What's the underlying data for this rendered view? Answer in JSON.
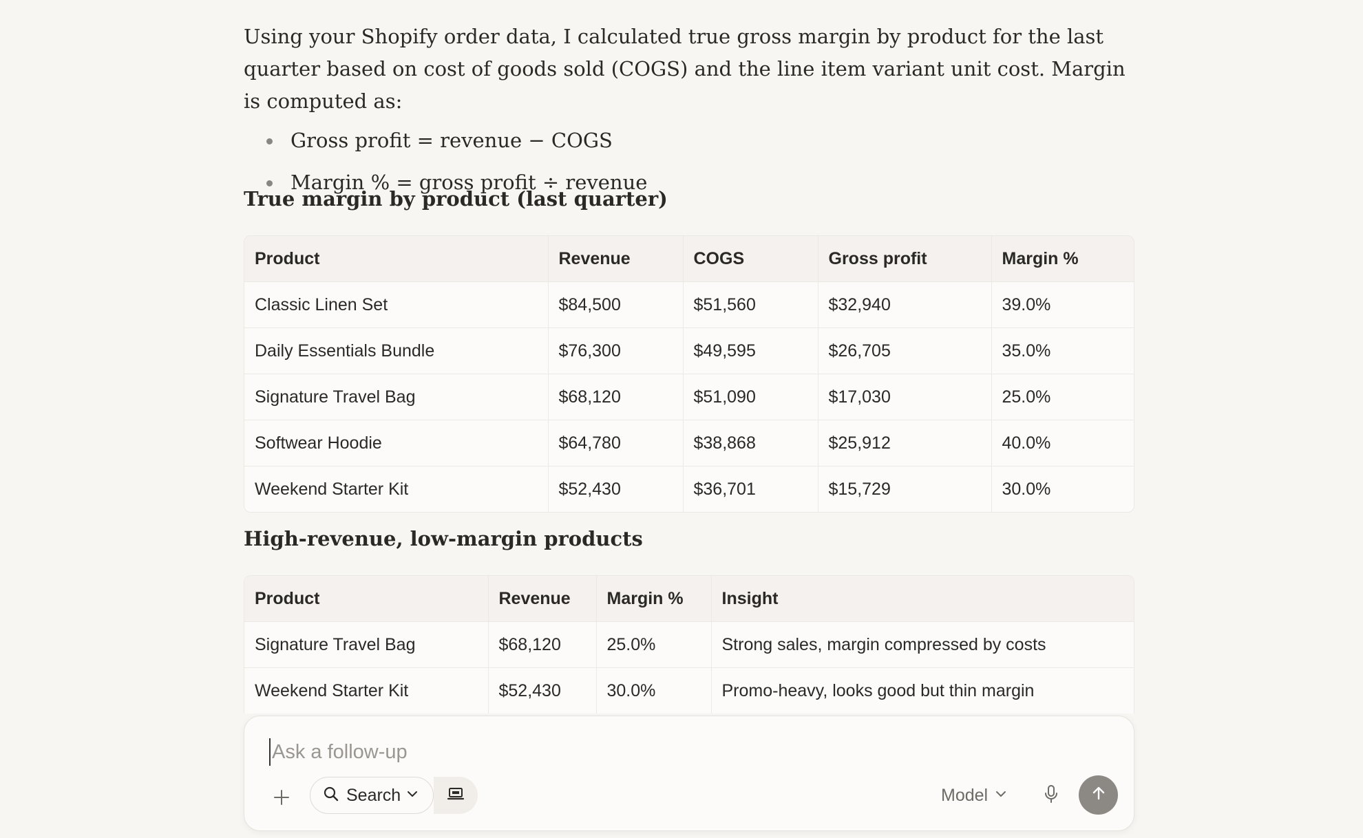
{
  "intro": {
    "paragraph": "Using your Shopify order data, I calculated true gross margin by product for the last quarter based on cost of goods sold (COGS) and the line item variant unit cost. Margin is computed as:",
    "bullets": [
      "Gross profit = revenue − COGS",
      "Margin % = gross profit ÷ revenue"
    ]
  },
  "margin_table": {
    "heading": "True margin by product (last quarter)",
    "headers": [
      "Product",
      "Revenue",
      "COGS",
      "Gross profit",
      "Margin %"
    ],
    "rows": [
      [
        "Classic Linen Set",
        "$84,500",
        "$51,560",
        "$32,940",
        "39.0%"
      ],
      [
        "Daily Essentials Bundle",
        "$76,300",
        "$49,595",
        "$26,705",
        "35.0%"
      ],
      [
        "Signature Travel Bag",
        "$68,120",
        "$51,090",
        "$17,030",
        "25.0%"
      ],
      [
        "Softwear Hoodie",
        "$64,780",
        "$38,868",
        "$25,912",
        "40.0%"
      ],
      [
        "Weekend Starter Kit",
        "$52,430",
        "$36,701",
        "$15,729",
        "30.0%"
      ]
    ]
  },
  "low_margin_table": {
    "heading": "High-revenue, low-margin products",
    "headers": [
      "Product",
      "Revenue",
      "Margin %",
      "Insight"
    ],
    "rows": [
      [
        "Signature Travel Bag",
        "$68,120",
        "25.0%",
        "Strong sales, margin compressed by costs"
      ],
      [
        "Weekend Starter Kit",
        "$52,430",
        "30.0%",
        "Promo-heavy, looks good but thin margin"
      ]
    ]
  },
  "composer": {
    "placeholder": "Ask a follow-up",
    "search_label": "Search",
    "model_label": "Model"
  },
  "icons": {
    "plus": "plus-icon",
    "search": "search-icon",
    "chevron": "chevron-down-icon",
    "extension": "laptop-icon",
    "mic": "microphone-icon",
    "send": "arrow-up-icon"
  },
  "colors": {
    "background": "#f8f6f3",
    "text": "#2b2926",
    "send_button": "#8c8884"
  }
}
